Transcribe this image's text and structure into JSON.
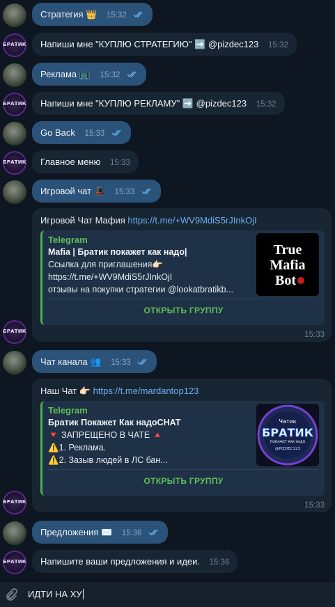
{
  "messages": [
    {
      "id": "m1",
      "text": "Стратегия 👑",
      "time": "15:32"
    },
    {
      "id": "m2",
      "text_before": "Напиши мне \"КУПЛЮ СТРАТЕГИЮ\" ➡️ ",
      "mention": "@pizdec123",
      "time": "15:32"
    },
    {
      "id": "m3",
      "text": "Реклама 📺",
      "time": "15:32"
    },
    {
      "id": "m4",
      "text_before": "Напиши мне \"КУПЛЮ РЕКЛАМУ\" ➡️ ",
      "mention": "@pizdec123",
      "time": "15:32"
    },
    {
      "id": "m5",
      "text": "Go Back",
      "time": "15:33"
    },
    {
      "id": "m6",
      "text": "Главное меню",
      "time": "15:33"
    },
    {
      "id": "m7",
      "text": "Игровой чат 🎩",
      "time": "15:33"
    },
    {
      "id": "m9",
      "text": "Чат канала 👥",
      "time": "15:33"
    },
    {
      "id": "m11",
      "text": "Предложения ✉️",
      "time": "15:36"
    },
    {
      "id": "m12",
      "text": "Напишите ваши предложения и идеи.",
      "time": "15:36"
    }
  ],
  "card1": {
    "head_text": "Игровой Чат Мафия ",
    "head_link": "https://t.me/+WV9MdiS5rJInkOjI",
    "site": "Telegram",
    "title": "Mafia | Братик покажет как надо|",
    "line1": "Cсылка для приглашения👉🏻",
    "line2": "https://t.me/+WV9MdiS5rJInkOjI",
    "line3": "отзывы на покупки стратегии @lookatbratikb...",
    "thumb_text": "True Mafia Bot",
    "button": "ОТКРЫТЬ ГРУППУ",
    "time": "15:33"
  },
  "card2": {
    "head_text": "Наш Чат 👉🏻 ",
    "head_link": "https://t.me/mardantop123",
    "site": "Telegram",
    "title": "Братик Покажет Как надоCHAT",
    "line1": "🔻 ЗАПРЕЩЕНО В  ЧАТЕ 🔺",
    "line2": "⚠️1. Реклама.",
    "line3": "⚠️2. Зазыв людей в ЛС бан...",
    "thumb_top": "Чатик",
    "thumb_main": "БРАТИК",
    "thumb_sub": "ПОКАЖЕТ КАК НАДО",
    "thumb_handle": "@PIZDEC123",
    "button": "ОТКРЫТЬ ГРУППУ",
    "time": "15:33"
  },
  "composer": {
    "value": "ИДТИ НА ХУ"
  },
  "colors": {
    "out_bubble": "#2b5278",
    "in_bubble": "#182533",
    "background": "#0e1621",
    "link": "#6ab3f3",
    "accent_green": "#5fbf5a"
  }
}
